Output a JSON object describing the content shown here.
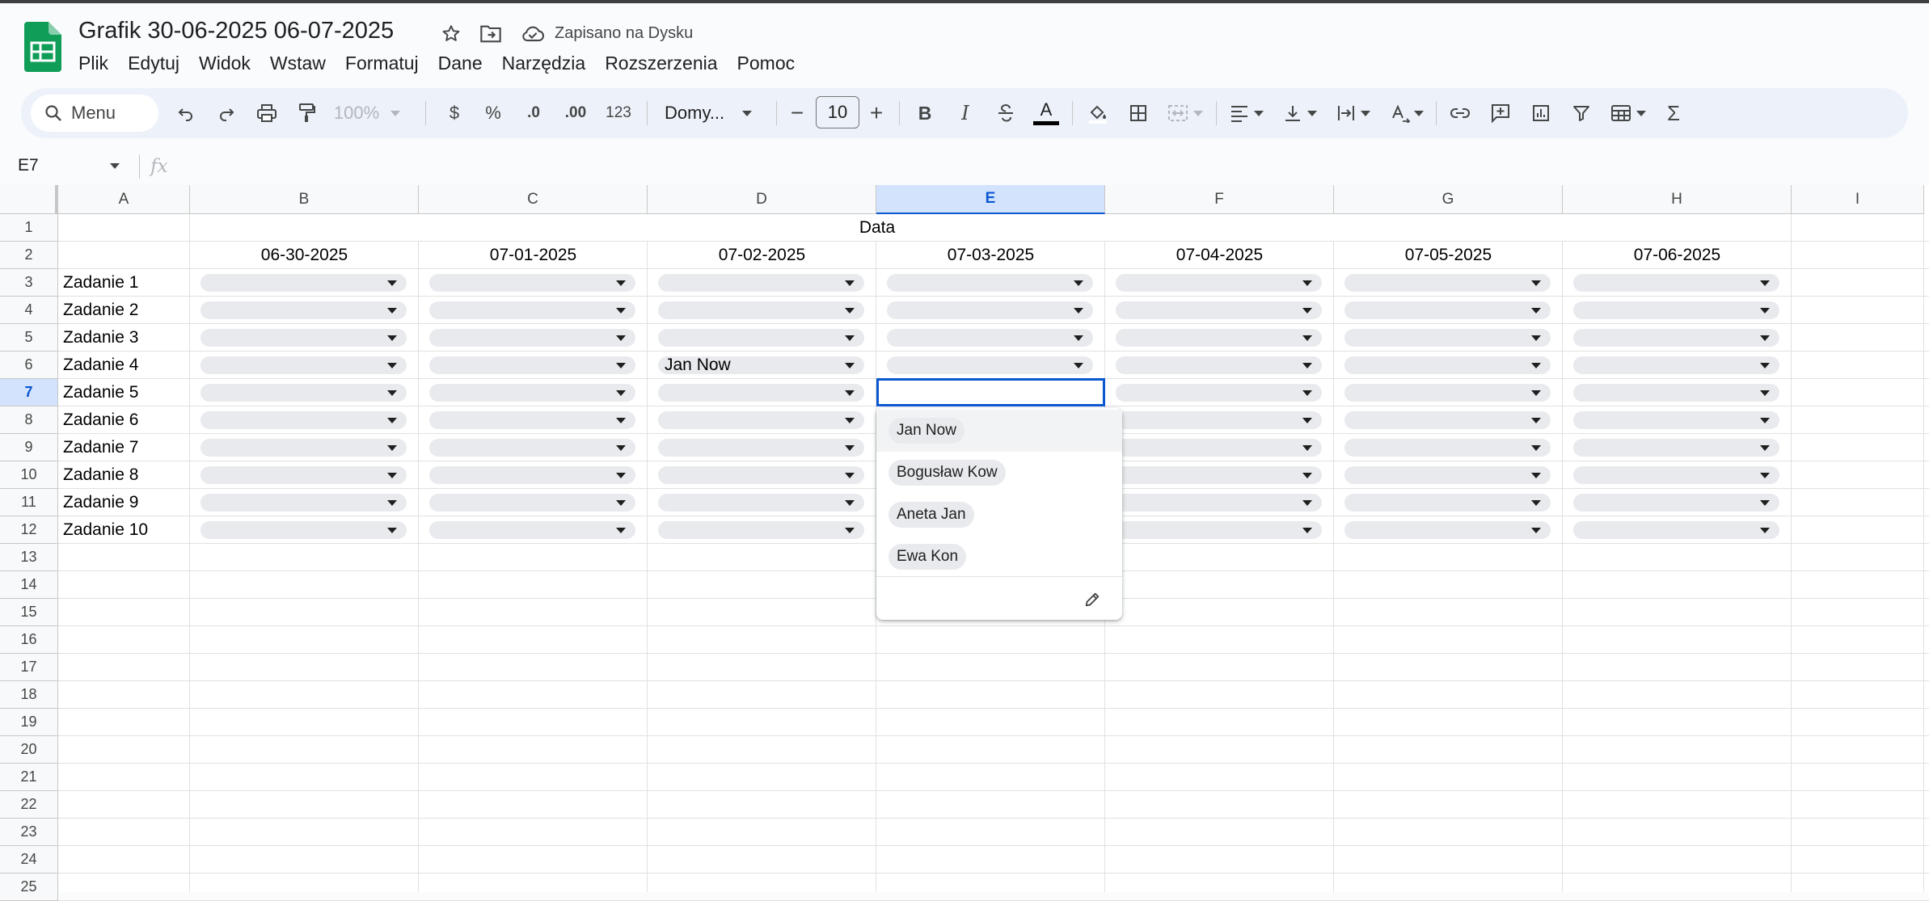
{
  "document": {
    "title": "Grafik 30-06-2025  06-07-2025",
    "saved_status": "Zapisano na Dysku"
  },
  "menu": [
    "Plik",
    "Edytuj",
    "Widok",
    "Wstaw",
    "Formatuj",
    "Dane",
    "Narzędzia",
    "Rozszerzenia",
    "Pomoc"
  ],
  "toolbar": {
    "search_label": "Menu",
    "zoom": "100%",
    "currency": "$",
    "percent": "%",
    "decrease_decimal": ".0",
    "increase_decimal": ".00",
    "number_format": "123",
    "font": "Domy...",
    "font_size": "10",
    "minus": "−",
    "plus": "+",
    "bold": "B",
    "italic": "I",
    "text_color_letter": "A",
    "sum": "Σ"
  },
  "formula_bar": {
    "name_box": "E7",
    "fx": "fx"
  },
  "sheet": {
    "columns": [
      "A",
      "B",
      "C",
      "D",
      "E",
      "F",
      "G",
      "H",
      "I"
    ],
    "selected_column": "E",
    "rows": [
      "1",
      "2",
      "3",
      "4",
      "5",
      "6",
      "7",
      "8",
      "9",
      "10",
      "11",
      "12",
      "13",
      "14",
      "15",
      "16",
      "17",
      "18",
      "19",
      "20",
      "21",
      "22",
      "23",
      "24",
      "25"
    ],
    "selected_row": "7",
    "header_label": "Data",
    "dates": [
      "06-30-2025",
      "07-01-2025",
      "07-02-2025",
      "07-03-2025",
      "07-04-2025",
      "07-05-2025",
      "07-06-2025"
    ],
    "tasks": [
      "Zadanie 1",
      "Zadanie 2",
      "Zadanie 3",
      "Zadanie 4",
      "Zadanie 5",
      "Zadanie 6",
      "Zadanie 7",
      "Zadanie 8",
      "Zadanie 9",
      "Zadanie 10"
    ],
    "filled_cells": [
      {
        "cell": "D6",
        "value": "Jan Now"
      }
    ]
  },
  "dropdown": {
    "options": [
      "Jan Now",
      "Bogusław Kow",
      "Aneta Jan",
      "Ewa Kon"
    ],
    "highlighted": "Jan Now"
  },
  "colors": {
    "accent": "#0b57d0",
    "toolbar_bg": "#edf2fa",
    "chip_bg": "#e8eaed",
    "sheets_green": "#0f9d58"
  }
}
